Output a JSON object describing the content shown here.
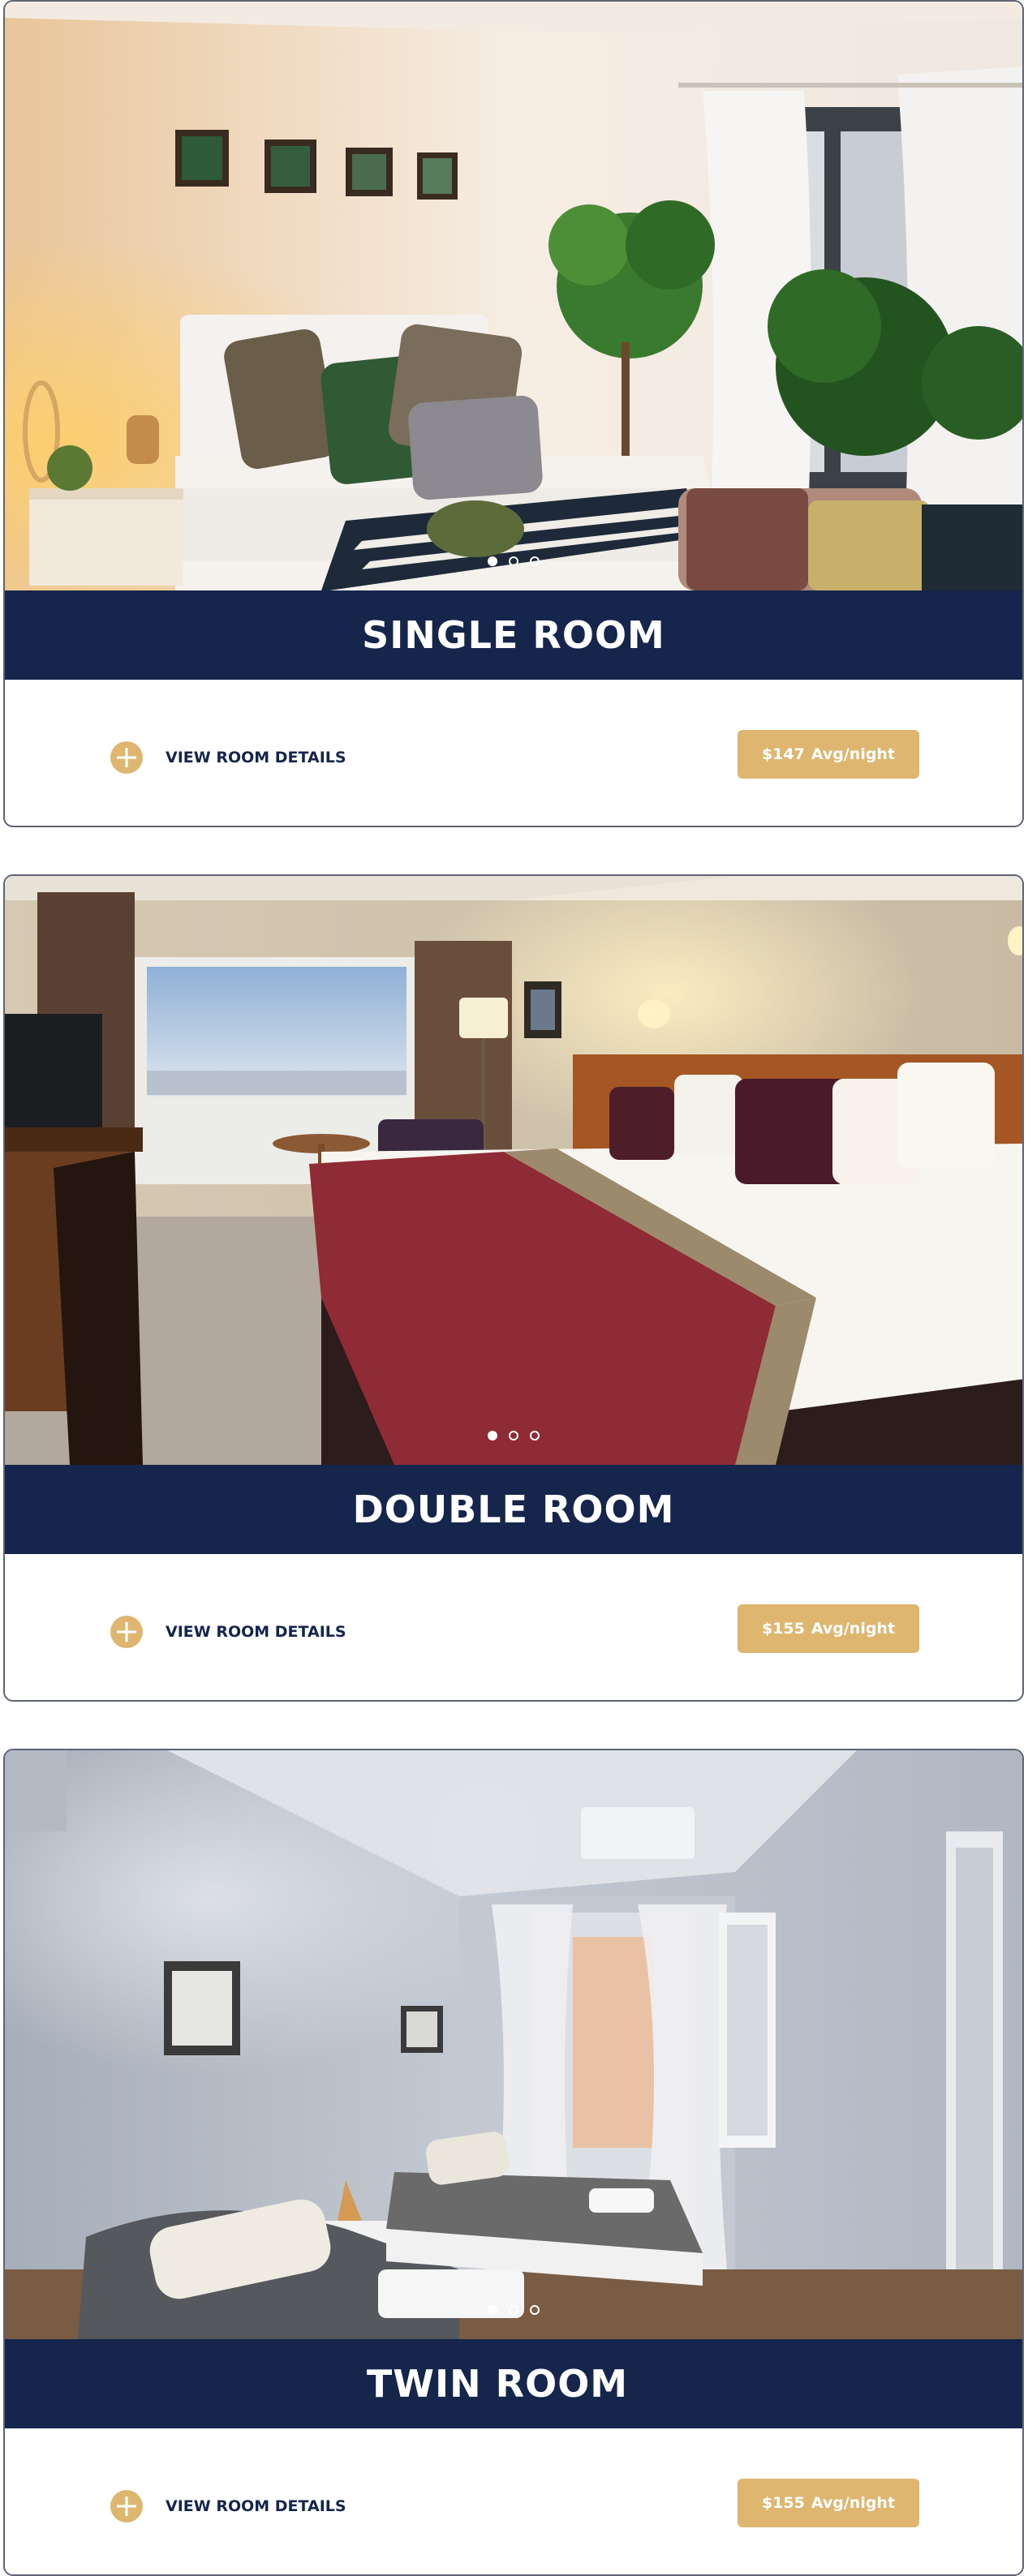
{
  "rooms": [
    {
      "title": "SINGLE ROOM",
      "details_label": "VIEW ROOM DETAILS",
      "price": "$147",
      "price_unit": "Avg/night",
      "active_slide": 1,
      "slides": 3
    },
    {
      "title": "DOUBLE ROOM",
      "details_label": "VIEW ROOM DETAILS",
      "price": "$155",
      "price_unit": "Avg/night",
      "active_slide": 1,
      "slides": 3
    },
    {
      "title": "TWIN ROOM",
      "details_label": "VIEW ROOM DETAILS",
      "price": "$155",
      "price_unit": "Avg/night",
      "active_slide": 1,
      "slides": 3
    }
  ],
  "colors": {
    "navy": "#15254c",
    "gold": "#deb670",
    "border": "#5e6375"
  },
  "icons": {
    "details": "plus-circle-icon"
  }
}
